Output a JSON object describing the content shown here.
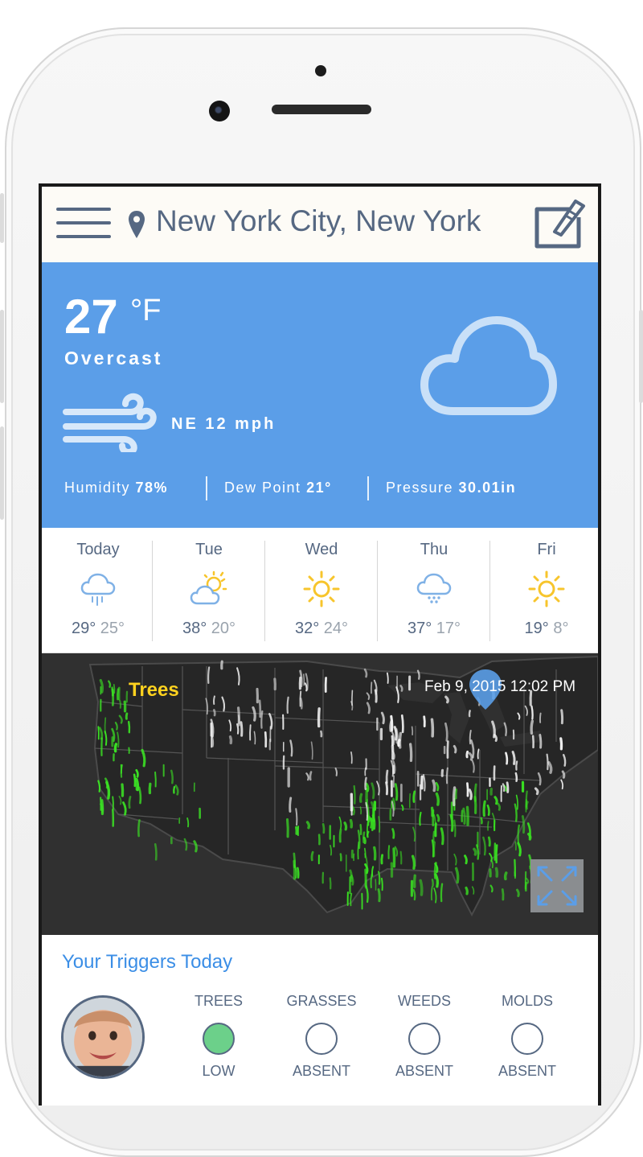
{
  "header": {
    "location": "New York City, New York"
  },
  "current": {
    "temp": "27",
    "unit": "°F",
    "condition": "Overcast",
    "wind": "NE 12 mph",
    "stats": [
      {
        "label": "Humidity",
        "value": "78%"
      },
      {
        "label": "Dew Point",
        "value": "21°"
      },
      {
        "label": "Pressure",
        "value": "30.01in"
      }
    ]
  },
  "forecast": [
    {
      "day": "Today",
      "icon": "rain-cloud-icon",
      "hi": "29°",
      "lo": "25°"
    },
    {
      "day": "Tue",
      "icon": "partly-sunny-icon",
      "hi": "38°",
      "lo": "20°"
    },
    {
      "day": "Wed",
      "icon": "sun-icon",
      "hi": "32°",
      "lo": "24°"
    },
    {
      "day": "Thu",
      "icon": "snow-cloud-icon",
      "hi": "37°",
      "lo": "17°"
    },
    {
      "day": "Fri",
      "icon": "sun-icon",
      "hi": "19°",
      "lo": "8°"
    }
  ],
  "map": {
    "layer": "Trees",
    "timestamp": "Feb 9, 2015 12:02 PM"
  },
  "triggers": {
    "title": "Your Triggers Today",
    "items": [
      {
        "name": "TREES",
        "level": "LOW",
        "active": true
      },
      {
        "name": "GRASSES",
        "level": "ABSENT",
        "active": false
      },
      {
        "name": "WEEDS",
        "level": "ABSENT",
        "active": false
      },
      {
        "name": "MOLDS",
        "level": "ABSENT",
        "active": false
      }
    ]
  },
  "colors": {
    "accent_blue": "#5b9ee8",
    "header_text": "#566882",
    "title_blue": "#3b8ee6",
    "low_green": "#6cd08a",
    "sun_yellow": "#f7c52c",
    "pollen_green": "#39e021",
    "map_label_yellow": "#ffd21f"
  }
}
